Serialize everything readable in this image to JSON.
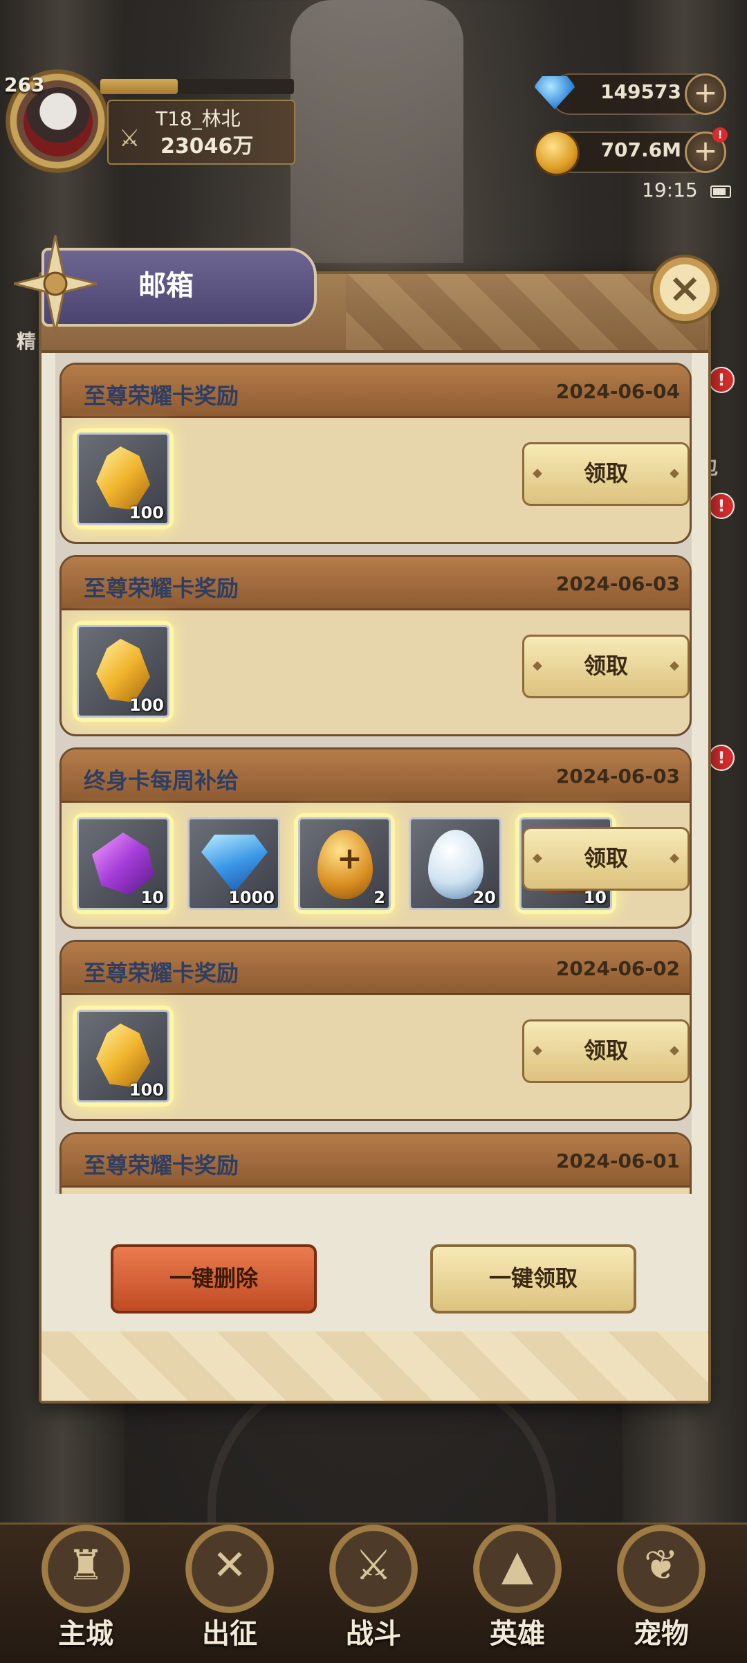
{
  "hud": {
    "level": "263",
    "player_name": "T18_林北",
    "power": "23046万",
    "exp_fraction": 0.4,
    "diamonds": "149573",
    "gold": "707.6M",
    "time": "19:15",
    "icons": {
      "diamond": "diamond-icon",
      "gold": "coin-icon",
      "add": "plus-icon",
      "power": "crossed-swords-icon"
    }
  },
  "mailbox": {
    "title": "邮箱",
    "claim_label": "领取",
    "delete_all_label": "一键删除",
    "claim_all_label": "一键领取",
    "mails": [
      {
        "title": "至尊荣耀卡奖励",
        "date": "2024-06-04",
        "items": [
          {
            "icon": "gold-crystal-icon",
            "count": "100"
          }
        ]
      },
      {
        "title": "至尊荣耀卡奖励",
        "date": "2024-06-03",
        "items": [
          {
            "icon": "gold-crystal-icon",
            "count": "100"
          }
        ]
      },
      {
        "title": "终身卡每周补给",
        "date": "2024-06-03",
        "items": [
          {
            "icon": "purple-crystal-icon",
            "count": "10"
          },
          {
            "icon": "blue-diamond-icon",
            "count": "1000"
          },
          {
            "icon": "gold-egg-icon",
            "count": "2"
          },
          {
            "icon": "white-egg-icon",
            "count": "20"
          },
          {
            "icon": "brown-item-icon",
            "count": "10"
          }
        ]
      },
      {
        "title": "至尊荣耀卡奖励",
        "date": "2024-06-02",
        "items": [
          {
            "icon": "gold-crystal-icon",
            "count": "100"
          }
        ]
      },
      {
        "title": "至尊荣耀卡奖励",
        "date": "2024-06-01",
        "items": []
      }
    ]
  },
  "side": {
    "left_label": "精",
    "right_label": "包"
  },
  "nav": [
    {
      "label": "主城",
      "icon": "castle-icon"
    },
    {
      "label": "出征",
      "icon": "crossed-axes-icon"
    },
    {
      "label": "战斗",
      "icon": "shield-swords-icon"
    },
    {
      "label": "英雄",
      "icon": "hooded-hero-icon"
    },
    {
      "label": "宠物",
      "icon": "dragon-pet-icon"
    }
  ],
  "colors": {
    "accent_red": "#d92b2b",
    "gold": "#dcc27e",
    "panel": "#ebe5d6",
    "title_blue": "#2e3e63"
  }
}
